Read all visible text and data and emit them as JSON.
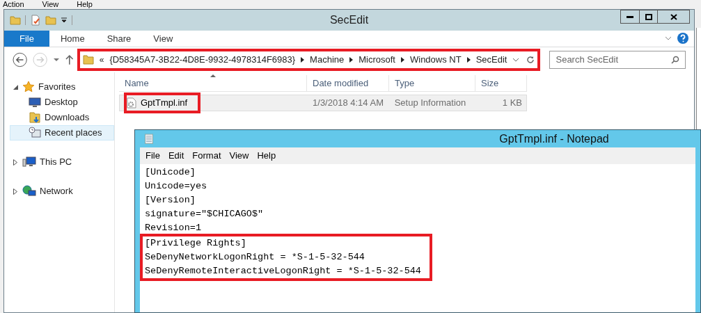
{
  "background_menu": [
    "Action",
    "View",
    "Help"
  ],
  "explorer": {
    "title": "SecEdit",
    "ribbon_tabs": [
      {
        "label": "File",
        "selected": true
      },
      {
        "label": "Home",
        "selected": false
      },
      {
        "label": "Share",
        "selected": false
      },
      {
        "label": "View",
        "selected": false
      }
    ],
    "address_bar": {
      "highlighted": true,
      "overflow": "«",
      "crumbs": [
        "{D58345A7-3B22-4D8E-9932-4978314F6983}",
        "Machine",
        "Microsoft",
        "Windows NT",
        "SecEdit"
      ]
    },
    "search": {
      "placeholder": "Search SecEdit"
    },
    "nav": [
      {
        "label": "Favorites",
        "kind": "group",
        "expanded": true,
        "selected": false
      },
      {
        "label": "Desktop",
        "kind": "item",
        "selected": false
      },
      {
        "label": "Downloads",
        "kind": "item",
        "selected": false
      },
      {
        "label": "Recent places",
        "kind": "item",
        "selected": true
      },
      {
        "label": "This PC",
        "kind": "group",
        "expanded": false,
        "selected": false
      },
      {
        "label": "Network",
        "kind": "group",
        "expanded": false,
        "selected": false
      }
    ],
    "columns": [
      "Name",
      "Date modified",
      "Type",
      "Size"
    ],
    "rows": [
      {
        "cells": [
          "GptTmpl.inf",
          "1/3/2018 4:14 AM",
          "Setup Information",
          "1 KB"
        ],
        "selected": true,
        "highlighted": true
      }
    ]
  },
  "notepad": {
    "title": "GptTmpl.inf - Notepad",
    "menu": [
      "File",
      "Edit",
      "Format",
      "View",
      "Help"
    ],
    "lines": [
      {
        "text": "[Unicode]",
        "highlighted": false
      },
      {
        "text": "Unicode=yes",
        "highlighted": false
      },
      {
        "text": "[Version]",
        "highlighted": false
      },
      {
        "text": "signature=\"$CHICAGO$\"",
        "highlighted": false
      },
      {
        "text": "Revision=1",
        "highlighted": false
      },
      {
        "text": "[Privilege Rights]",
        "highlighted": true
      },
      {
        "text": "SeDenyNetworkLogonRight = *S-1-5-32-544",
        "highlighted": true
      },
      {
        "text": "SeDenyRemoteInteractiveLogonRight = *S-1-5-32-544",
        "highlighted": true
      }
    ]
  }
}
